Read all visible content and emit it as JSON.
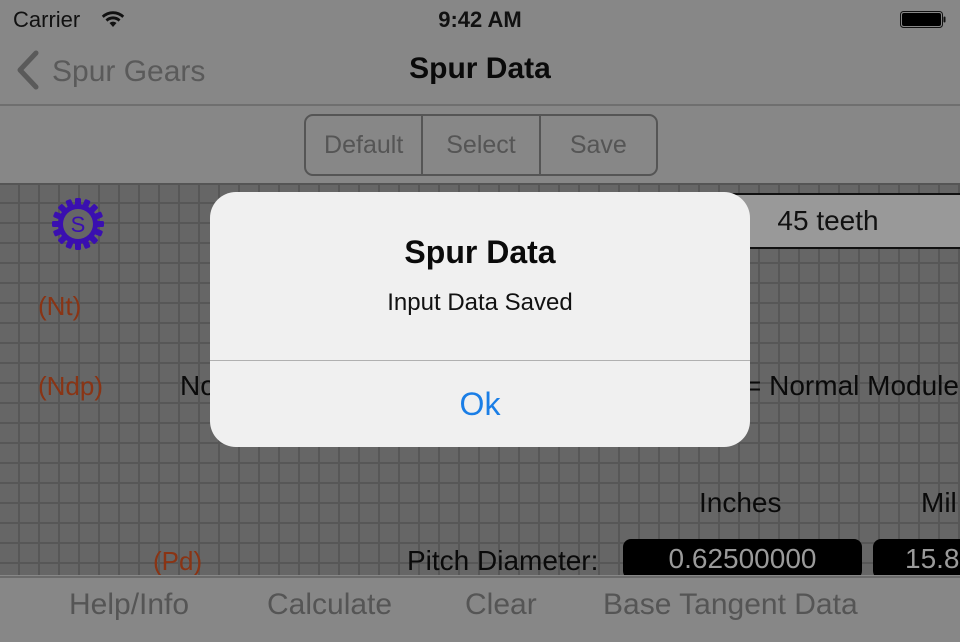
{
  "status_bar": {
    "carrier": "Carrier",
    "time": "9:42 AM",
    "wifi_icon": "wifi-icon",
    "battery_icon": "battery-full-icon"
  },
  "nav_bar": {
    "back_label": "Spur Gears",
    "back_icon": "chevron-left-icon",
    "title": "Spur Data"
  },
  "toolbar": {
    "segments": [
      {
        "label": "Default"
      },
      {
        "label": "Select"
      },
      {
        "label": "Save"
      }
    ]
  },
  "content": {
    "logo_icon": "gear-s-icon",
    "logo_letter": "S",
    "teeth_value": "45 teeth",
    "labels": {
      "nt": "(Nt)",
      "ndp": "(Ndp)",
      "pd": "(Pd)"
    },
    "ndp_row_left_text": "No",
    "ndp_row_right_text": "= Normal Module",
    "column_headers": {
      "inches": "Inches",
      "millimeters": "Mil"
    },
    "pitch_diameter": {
      "label": "Pitch Diameter:",
      "inches": "0.62500000",
      "millimeters": "15.8"
    }
  },
  "tab_bar": {
    "items": [
      {
        "label": "Help/Info"
      },
      {
        "label": "Calculate"
      },
      {
        "label": "Clear"
      },
      {
        "label": "Base Tangent Data"
      }
    ]
  },
  "alert": {
    "title": "Spur Data",
    "message": "Input Data Saved",
    "button_label": "Ok"
  },
  "colors": {
    "accent_blue": "#1a7ee6",
    "label_red": "#8a3414",
    "logo_purple": "#3a0fb0",
    "dim_overlay_gray": "#878787"
  }
}
